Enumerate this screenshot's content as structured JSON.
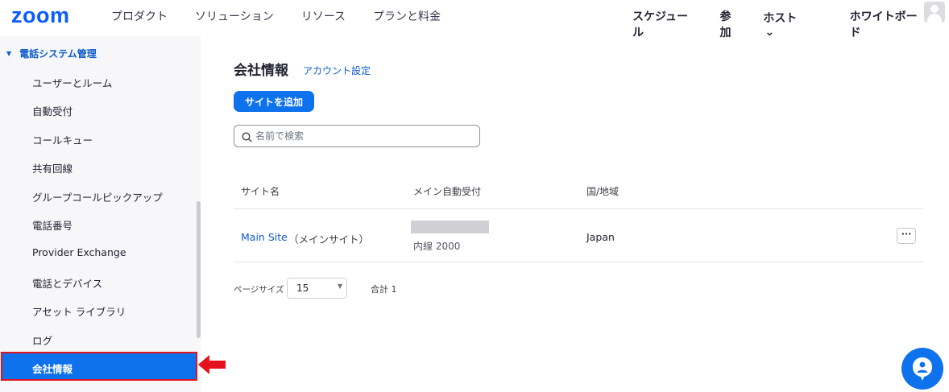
{
  "header": {
    "logo_text": "zoom",
    "nav_left": [
      "プロダクト",
      "ソリューション",
      "リソース",
      "プランと料金"
    ],
    "schedule": "スケジュール",
    "join": "参加",
    "host": "ホスト",
    "whiteboard": "ホワイトボード"
  },
  "sidebar": {
    "section": "電話システム管理",
    "items": [
      "ユーザーとルーム",
      "自動受付",
      "コールキュー",
      "共有回線",
      "グループコールピックアップ",
      "電話番号",
      "Provider Exchange",
      "電話とデバイス",
      "アセット ライブラリ",
      "ログ"
    ],
    "active_item": "会社情報"
  },
  "main": {
    "title": "会社情報",
    "account_link": "アカウント設定",
    "add_button": "サイトを追加",
    "search_placeholder": "名前で検索",
    "columns": [
      "サイト名",
      "メイン自動受付",
      "国/地域"
    ],
    "row": {
      "site_name": "Main Site",
      "site_sub": "（メインサイト）",
      "extension": "内線 2000",
      "country": "Japan"
    },
    "more": "···",
    "pagination": {
      "label": "ページサイズ",
      "size": "15",
      "total": "合計 1"
    }
  },
  "colors": {
    "brand": "#0b5cff",
    "primary": "#0e72ed",
    "link": "#0e5cc9",
    "highlight_border": "#e5121e"
  }
}
